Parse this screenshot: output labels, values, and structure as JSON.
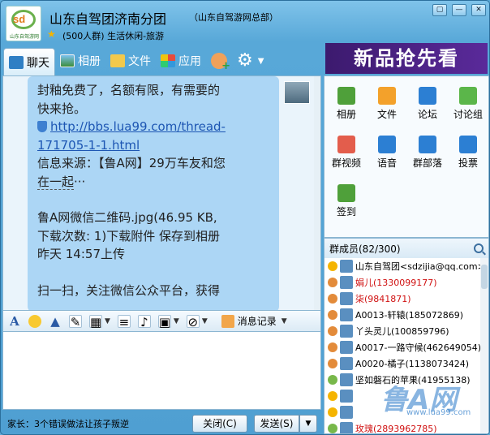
{
  "window": {
    "group_name": "山东自驾团济南分团",
    "group_org": "（山东自驾游网总部）",
    "group_desc": "(500人群) 生活休闲-旅游",
    "avatar_text": "sd",
    "avatar_sub": "山东自驾游网",
    "controls": [
      "▢",
      "—",
      "✕"
    ]
  },
  "toolbar": {
    "tabs": [
      {
        "label": "聊天",
        "icon": "chat-icon"
      },
      {
        "label": "相册",
        "icon": "album-icon"
      },
      {
        "label": "文件",
        "icon": "folder-icon"
      },
      {
        "label": "应用",
        "icon": "apps-icon"
      }
    ]
  },
  "banner": {
    "text": "新品抢先看"
  },
  "chat": {
    "line1": "封釉免费了，名额有限，有需要的",
    "line2": "快来抢。",
    "link": "http://bbs.lua99.com/thread-171705-1-1.html",
    "source_prefix": "信息来源：【鲁A网】29万车友和您",
    "source_link": "在一起",
    "source_suffix": "···",
    "file_line": "鲁A网微信二维码.jpg(46.95 KB,",
    "file_line2": "下载次数: 1)下载附件  保存到相册",
    "file_time": "昨天 14:57上传",
    "scan_line": "扫一扫，关注微信公众平台，获得"
  },
  "format_bar": {
    "msg_log": "消息记录"
  },
  "bottom": {
    "status": "家长：3个错误做法让孩子叛逆",
    "close_label": "关闭(C)",
    "send_label": "发送(S)"
  },
  "apps": [
    {
      "label": "相册",
      "icon": "photo-icon",
      "color": "#4fa03a"
    },
    {
      "label": "文件",
      "icon": "file-icon",
      "color": "#f3a12b"
    },
    {
      "label": "论坛",
      "icon": "forum-icon",
      "color": "#2c7fd3"
    },
    {
      "label": "讨论组",
      "icon": "discussion-icon",
      "color": "#5bb64a"
    },
    {
      "label": "群视频",
      "icon": "video-icon",
      "color": "#e35d4c"
    },
    {
      "label": "语音",
      "icon": "voice-icon",
      "color": "#2c7fd3"
    },
    {
      "label": "群部落",
      "icon": "tribe-icon",
      "color": "#2c7fd3"
    },
    {
      "label": "投票",
      "icon": "vote-icon",
      "color": "#2c7fd3"
    },
    {
      "label": "签到",
      "icon": "checkin-icon",
      "color": "#4fa03a"
    }
  ],
  "members": {
    "header": "群成员(82/300)",
    "list": [
      {
        "name": "山东自驾团<sdzijia@qq.com>",
        "role": "owner",
        "red": false
      },
      {
        "name": "娟儿(1330099177)",
        "role": "admin",
        "red": true
      },
      {
        "name": "柒(9841871)",
        "role": "admin",
        "red": true
      },
      {
        "name": "A0013-轩辕(185072869)",
        "role": "admin",
        "red": false
      },
      {
        "name": "丫头灵儿(100859796)",
        "role": "admin",
        "red": false
      },
      {
        "name": "A0017-一路守候(462649054)",
        "role": "admin",
        "red": false
      },
      {
        "name": "A0020-橘子(1138073424)",
        "role": "admin",
        "red": false
      },
      {
        "name": "坚如磐石的苹果(41955138)",
        "role": "member",
        "red": false
      },
      {
        "name": "",
        "role": "owner",
        "red": false
      },
      {
        "name": "",
        "role": "owner",
        "red": false
      },
      {
        "name": "玫瑰(2893962785)",
        "role": "member",
        "red": true
      }
    ]
  },
  "watermark": {
    "text": "鲁A网",
    "url": "www.lua99.com"
  }
}
